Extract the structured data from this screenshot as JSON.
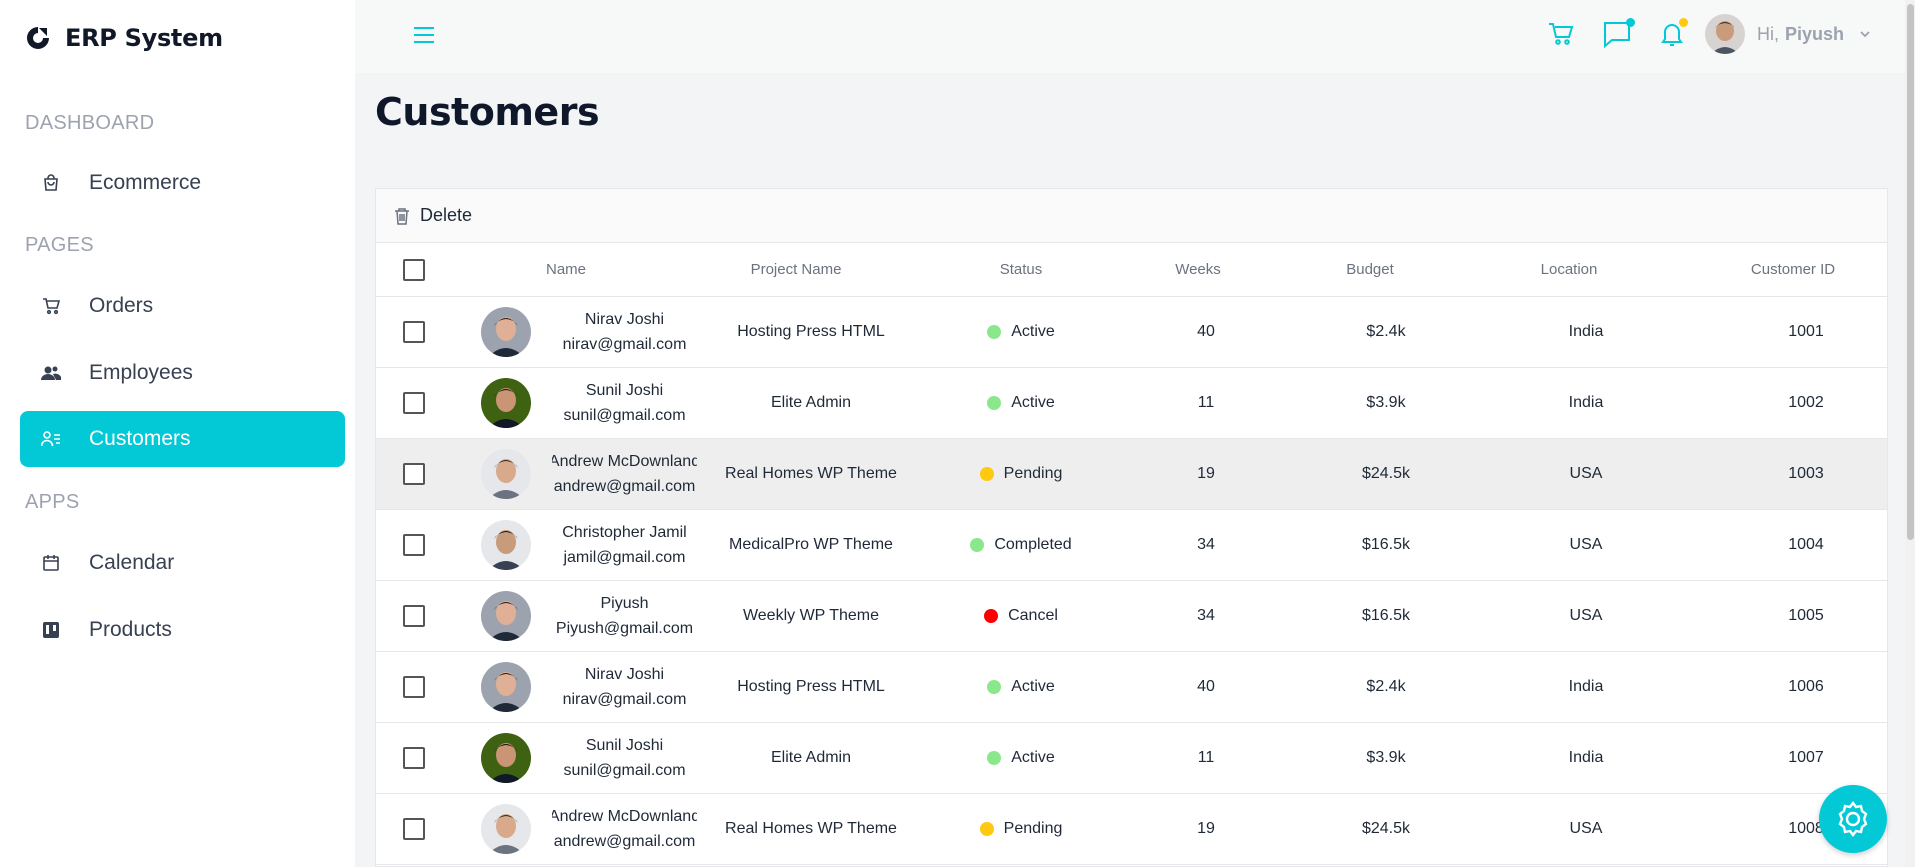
{
  "app": {
    "title": "ERP System"
  },
  "sidebar": {
    "sections": [
      {
        "title": "DASHBOARD",
        "items": [
          {
            "label": "Ecommerce",
            "icon": "shopping-bag-icon"
          }
        ]
      },
      {
        "title": "PAGES",
        "items": [
          {
            "label": "Orders",
            "icon": "cart-icon"
          },
          {
            "label": "Employees",
            "icon": "users-icon"
          },
          {
            "label": "Customers",
            "icon": "user-list-icon",
            "active": true
          }
        ]
      },
      {
        "title": "APPS",
        "items": [
          {
            "label": "Calendar",
            "icon": "calendar-icon"
          },
          {
            "label": "Products",
            "icon": "kanban-icon"
          }
        ]
      }
    ],
    "accent_color": "#03c9d7"
  },
  "topbar": {
    "greeting": "Hi,",
    "user_name": "Piyush",
    "icons": [
      "cart-icon",
      "chat-icon",
      "bell-icon"
    ],
    "chat_dot_color": "#03c9d7",
    "bell_dot_color": "#fec90f"
  },
  "page": {
    "title": "Customers"
  },
  "grid": {
    "toolbar": {
      "delete_label": "Delete"
    },
    "columns": {
      "name": "Name",
      "project": "Project Name",
      "status": "Status",
      "weeks": "Weeks",
      "budget": "Budget",
      "location": "Location",
      "customer_id": "Customer ID"
    },
    "rows": [
      {
        "name": "Nirav Joshi",
        "email": "nirav@gmail.com",
        "project": "Hosting Press HTML",
        "status": "Active",
        "status_color": "#8be78b",
        "weeks": "40",
        "budget": "$2.4k",
        "location": "India",
        "customer_id": "1001"
      },
      {
        "name": "Sunil Joshi",
        "email": "sunil@gmail.com",
        "project": "Elite Admin",
        "status": "Active",
        "status_color": "#8be78b",
        "weeks": "11",
        "budget": "$3.9k",
        "location": "India",
        "customer_id": "1002"
      },
      {
        "name": "Andrew McDownland",
        "email": "andrew@gmail.com",
        "project": "Real Homes WP Theme",
        "status": "Pending",
        "status_color": "#fec90f",
        "weeks": "19",
        "budget": "$24.5k",
        "location": "USA",
        "customer_id": "1003"
      },
      {
        "name": "Christopher Jamil",
        "email": "jamil@gmail.com",
        "project": "MedicalPro WP Theme",
        "status": "Completed",
        "status_color": "#8be78b",
        "weeks": "34",
        "budget": "$16.5k",
        "location": "USA",
        "customer_id": "1004"
      },
      {
        "name": "Piyush",
        "email": "Piyush@gmail.com",
        "project": "Weekly WP Theme",
        "status": "Cancel",
        "status_color": "#ff0000",
        "weeks": "34",
        "budget": "$16.5k",
        "location": "USA",
        "customer_id": "1005"
      },
      {
        "name": "Nirav Joshi",
        "email": "nirav@gmail.com",
        "project": "Hosting Press HTML",
        "status": "Active",
        "status_color": "#8be78b",
        "weeks": "40",
        "budget": "$2.4k",
        "location": "India",
        "customer_id": "1006"
      },
      {
        "name": "Sunil Joshi",
        "email": "sunil@gmail.com",
        "project": "Elite Admin",
        "status": "Active",
        "status_color": "#8be78b",
        "weeks": "11",
        "budget": "$3.9k",
        "location": "India",
        "customer_id": "1007"
      },
      {
        "name": "Andrew McDownland",
        "email": "andrew@gmail.com",
        "project": "Real Homes WP Theme",
        "status": "Pending",
        "status_color": "#fec90f",
        "weeks": "19",
        "budget": "$24.5k",
        "location": "USA",
        "customer_id": "1008"
      }
    ]
  }
}
